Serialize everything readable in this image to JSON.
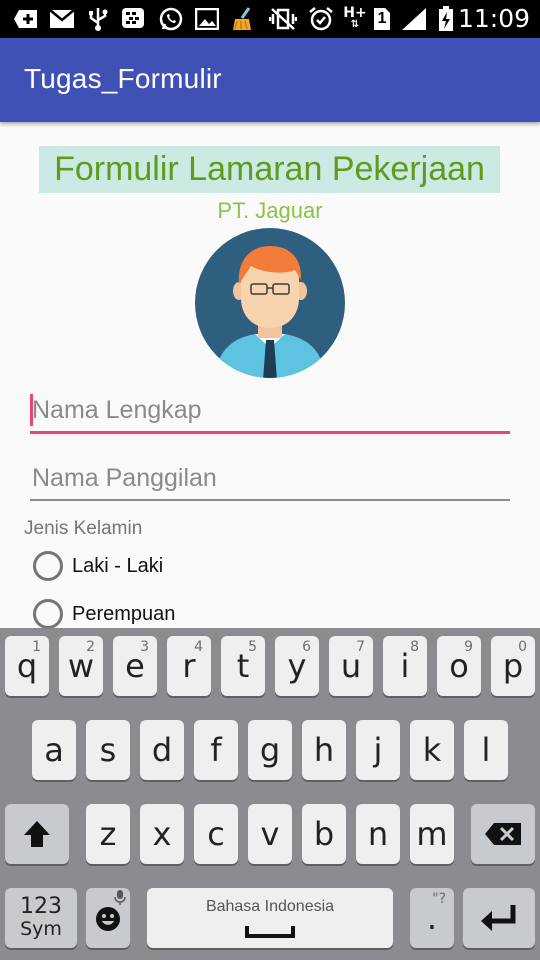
{
  "status_bar": {
    "time": "11:09",
    "icons": [
      "add-box-icon",
      "email-icon",
      "usb-icon",
      "bbm-icon",
      "whatsapp-icon",
      "image-icon",
      "cleaner-icon",
      "vibrate-off-icon",
      "alarm-icon",
      "hplus-data-icon",
      "sim1-icon",
      "signal-icon",
      "battery-charging-icon"
    ],
    "hplus_label": "H+",
    "sim_label": "1"
  },
  "app_bar": {
    "title": "Tugas_Formulir",
    "color": "#3f51b5"
  },
  "form": {
    "title": "Formulir Lamaran Pekerjaan",
    "subtitle": "PT. Jaguar",
    "avatar": "male-avatar-illustration",
    "fields": [
      {
        "placeholder": "Nama Lengkap",
        "value": "",
        "focused": true
      },
      {
        "placeholder": "Nama Panggilan",
        "value": "",
        "focused": false
      }
    ],
    "gender": {
      "label": "Jenis Kelamin",
      "options": [
        {
          "label": "Laki - Laki",
          "checked": false
        },
        {
          "label": "Perempuan",
          "checked": false
        }
      ]
    }
  },
  "keyboard": {
    "row1": [
      {
        "k": "q",
        "h": "1"
      },
      {
        "k": "w",
        "h": "2"
      },
      {
        "k": "e",
        "h": "3"
      },
      {
        "k": "r",
        "h": "4"
      },
      {
        "k": "t",
        "h": "5"
      },
      {
        "k": "y",
        "h": "6"
      },
      {
        "k": "u",
        "h": "7"
      },
      {
        "k": "i",
        "h": "8"
      },
      {
        "k": "o",
        "h": "9"
      },
      {
        "k": "p",
        "h": "0"
      }
    ],
    "row2": [
      "a",
      "s",
      "d",
      "f",
      "g",
      "h",
      "j",
      "k",
      "l"
    ],
    "row3": [
      "z",
      "x",
      "c",
      "v",
      "b",
      "n",
      "m"
    ],
    "sym_top": "123",
    "sym_bottom": "Sym",
    "space_label": "Bahasa Indonesia",
    "period": ".",
    "period_hint": "\"?",
    "shift_icon": "shift-icon",
    "backspace_icon": "backspace-icon",
    "emoji_icon": "emoji-icon",
    "enter_icon": "enter-icon"
  }
}
